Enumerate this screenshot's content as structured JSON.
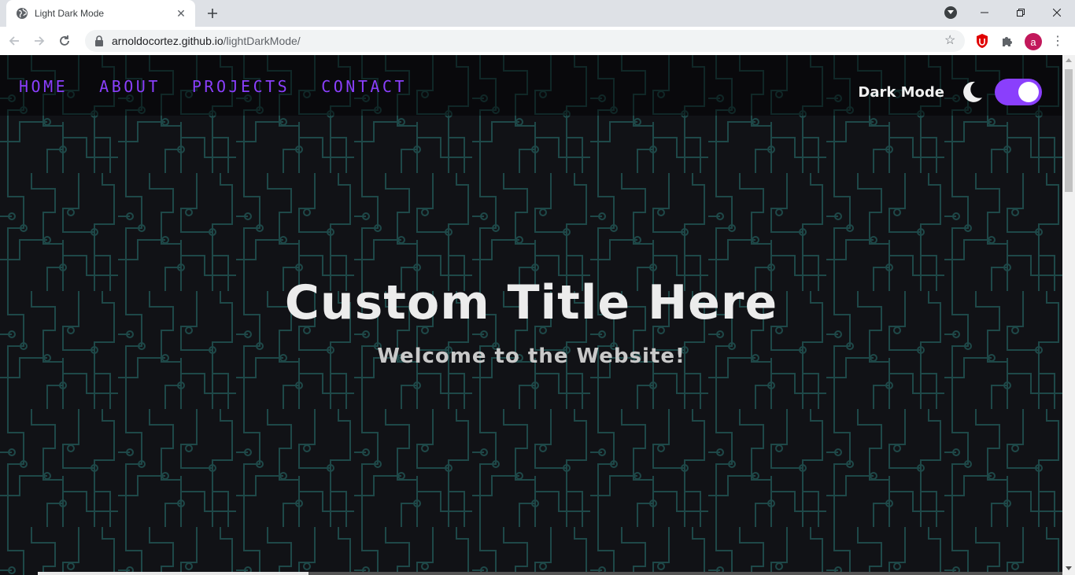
{
  "browser": {
    "tab_title": "Light Dark Mode",
    "url_host": "arnoldocortez.github.io",
    "url_path": "/lightDarkMode/",
    "profile_initial": "a"
  },
  "nav": {
    "links": [
      "HOME",
      "ABOUT",
      "PROJECTS",
      "CONTACT"
    ]
  },
  "theme_toggle": {
    "label": "Dark Mode",
    "state": "on"
  },
  "hero": {
    "title": "Custom Title Here",
    "subtitle": "Welcome to the Website!"
  },
  "colors": {
    "accent": "#8a3ffc",
    "background": "#111216",
    "circuit": "#1f4f4f"
  }
}
